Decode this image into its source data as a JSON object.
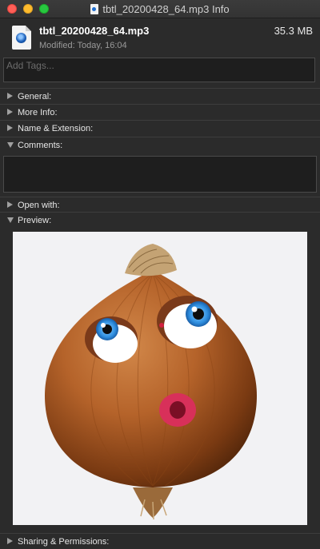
{
  "window": {
    "title": "tbtl_20200428_64.mp3 Info"
  },
  "file": {
    "name": "tbtl_20200428_64.mp3",
    "size": "35.3 MB",
    "modified": "Modified: Today, 16:04"
  },
  "tags": {
    "placeholder": "Add Tags..."
  },
  "sections": {
    "general": "General:",
    "more_info": "More Info:",
    "name_extension": "Name & Extension:",
    "comments": "Comments:",
    "open_with": "Open with:",
    "preview": "Preview:",
    "sharing": "Sharing & Permissions:"
  },
  "colors": {
    "close": "#ff5f57",
    "minimize": "#febc2e",
    "maximize": "#28c840",
    "background": "#2b2b2b"
  }
}
